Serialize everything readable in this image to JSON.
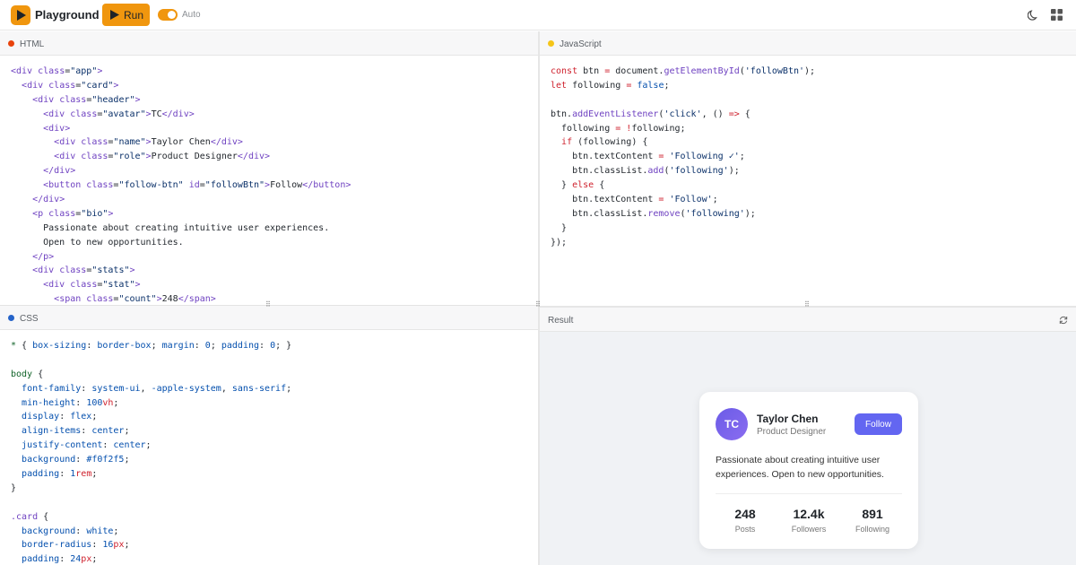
{
  "app": {
    "title": "Playground",
    "run_label": "Run",
    "auto_label": "Auto",
    "auto_enabled": true,
    "accent": "#f0960e"
  },
  "panes": {
    "html": {
      "label": "HTML",
      "dot_color": "#e8430c",
      "lines": [
        [
          [
            "t",
            "<div "
          ],
          [
            "a",
            "class"
          ],
          [
            "p",
            "="
          ],
          [
            "s",
            "\"app\""
          ],
          [
            "t",
            ">"
          ]
        ],
        [
          [
            "p",
            "  "
          ],
          [
            "t",
            "<div "
          ],
          [
            "a",
            "class"
          ],
          [
            "p",
            "="
          ],
          [
            "s",
            "\"card\""
          ],
          [
            "t",
            ">"
          ]
        ],
        [
          [
            "p",
            "    "
          ],
          [
            "t",
            "<div "
          ],
          [
            "a",
            "class"
          ],
          [
            "p",
            "="
          ],
          [
            "s",
            "\"header\""
          ],
          [
            "t",
            ">"
          ]
        ],
        [
          [
            "p",
            "      "
          ],
          [
            "t",
            "<div "
          ],
          [
            "a",
            "class"
          ],
          [
            "p",
            "="
          ],
          [
            "s",
            "\"avatar\""
          ],
          [
            "t",
            ">"
          ],
          [
            "p",
            "TC"
          ],
          [
            "t",
            "</div>"
          ]
        ],
        [
          [
            "p",
            "      "
          ],
          [
            "t",
            "<div>"
          ]
        ],
        [
          [
            "p",
            "        "
          ],
          [
            "t",
            "<div "
          ],
          [
            "a",
            "class"
          ],
          [
            "p",
            "="
          ],
          [
            "s",
            "\"name\""
          ],
          [
            "t",
            ">"
          ],
          [
            "p",
            "Taylor Chen"
          ],
          [
            "t",
            "</div>"
          ]
        ],
        [
          [
            "p",
            "        "
          ],
          [
            "t",
            "<div "
          ],
          [
            "a",
            "class"
          ],
          [
            "p",
            "="
          ],
          [
            "s",
            "\"role\""
          ],
          [
            "t",
            ">"
          ],
          [
            "p",
            "Product Designer"
          ],
          [
            "t",
            "</div>"
          ]
        ],
        [
          [
            "p",
            "      "
          ],
          [
            "t",
            "</div>"
          ]
        ],
        [
          [
            "p",
            "      "
          ],
          [
            "t",
            "<button "
          ],
          [
            "a",
            "class"
          ],
          [
            "p",
            "="
          ],
          [
            "s",
            "\"follow-btn\""
          ],
          [
            "p",
            " "
          ],
          [
            "a",
            "id"
          ],
          [
            "p",
            "="
          ],
          [
            "s",
            "\"followBtn\""
          ],
          [
            "t",
            ">"
          ],
          [
            "p",
            "Follow"
          ],
          [
            "t",
            "</button>"
          ]
        ],
        [
          [
            "p",
            "    "
          ],
          [
            "t",
            "</div>"
          ]
        ],
        [
          [
            "p",
            "    "
          ],
          [
            "t",
            "<p "
          ],
          [
            "a",
            "class"
          ],
          [
            "p",
            "="
          ],
          [
            "s",
            "\"bio\""
          ],
          [
            "t",
            ">"
          ]
        ],
        [
          [
            "p",
            "      Passionate about creating intuitive user experiences."
          ]
        ],
        [
          [
            "p",
            "      Open to new opportunities."
          ]
        ],
        [
          [
            "p",
            "    "
          ],
          [
            "t",
            "</p>"
          ]
        ],
        [
          [
            "p",
            "    "
          ],
          [
            "t",
            "<div "
          ],
          [
            "a",
            "class"
          ],
          [
            "p",
            "="
          ],
          [
            "s",
            "\"stats\""
          ],
          [
            "t",
            ">"
          ]
        ],
        [
          [
            "p",
            "      "
          ],
          [
            "t",
            "<div "
          ],
          [
            "a",
            "class"
          ],
          [
            "p",
            "="
          ],
          [
            "s",
            "\"stat\""
          ],
          [
            "t",
            ">"
          ]
        ],
        [
          [
            "p",
            "        "
          ],
          [
            "t",
            "<span "
          ],
          [
            "a",
            "class"
          ],
          [
            "p",
            "="
          ],
          [
            "s",
            "\"count\""
          ],
          [
            "t",
            ">"
          ],
          [
            "p",
            "248"
          ],
          [
            "t",
            "</span>"
          ]
        ]
      ]
    },
    "js": {
      "label": "JavaScript",
      "dot_color": "#f5c518",
      "lines": [
        [
          [
            "k",
            "const "
          ],
          [
            "p",
            "btn "
          ],
          [
            "k",
            "= "
          ],
          [
            "p",
            "document."
          ],
          [
            "t",
            "getElementById"
          ],
          [
            "p",
            "("
          ],
          [
            "s",
            "'followBtn'"
          ],
          [
            "p",
            ");"
          ]
        ],
        [
          [
            "k",
            "let "
          ],
          [
            "p",
            "following "
          ],
          [
            "k",
            "= "
          ],
          [
            "val",
            "false"
          ],
          [
            "p",
            ";"
          ]
        ],
        [
          [
            "p",
            ""
          ]
        ],
        [
          [
            "p",
            "btn."
          ],
          [
            "t",
            "addEventListener"
          ],
          [
            "p",
            "("
          ],
          [
            "s",
            "'click'"
          ],
          [
            "p",
            ", () "
          ],
          [
            "k",
            "=> "
          ],
          [
            "p",
            "{"
          ]
        ],
        [
          [
            "p",
            "  following "
          ],
          [
            "k",
            "= "
          ],
          [
            "k",
            "!"
          ],
          [
            "p",
            "following;"
          ]
        ],
        [
          [
            "p",
            "  "
          ],
          [
            "k",
            "if "
          ],
          [
            "p",
            "(following) {"
          ]
        ],
        [
          [
            "p",
            "    btn.textContent "
          ],
          [
            "k",
            "= "
          ],
          [
            "s",
            "'Following ✓'"
          ],
          [
            "p",
            ";"
          ]
        ],
        [
          [
            "p",
            "    btn.classList."
          ],
          [
            "t",
            "add"
          ],
          [
            "p",
            "("
          ],
          [
            "s",
            "'following'"
          ],
          [
            "p",
            ");"
          ]
        ],
        [
          [
            "p",
            "  } "
          ],
          [
            "k",
            "else "
          ],
          [
            "p",
            "{"
          ]
        ],
        [
          [
            "p",
            "    btn.textContent "
          ],
          [
            "k",
            "= "
          ],
          [
            "s",
            "'Follow'"
          ],
          [
            "p",
            ";"
          ]
        ],
        [
          [
            "p",
            "    btn.classList."
          ],
          [
            "t",
            "remove"
          ],
          [
            "p",
            "("
          ],
          [
            "s",
            "'following'"
          ],
          [
            "p",
            ");"
          ]
        ],
        [
          [
            "p",
            "  }"
          ]
        ],
        [
          [
            "p",
            "});"
          ]
        ]
      ]
    },
    "css": {
      "label": "CSS",
      "dot_color": "#2563c9",
      "lines": [
        [
          [
            "sel",
            "* "
          ],
          [
            "p",
            "{ "
          ],
          [
            "prop",
            "box-sizing"
          ],
          [
            "p",
            ": "
          ],
          [
            "val",
            "border-box"
          ],
          [
            "p",
            "; "
          ],
          [
            "prop",
            "margin"
          ],
          [
            "p",
            ": "
          ],
          [
            "val",
            "0"
          ],
          [
            "p",
            "; "
          ],
          [
            "prop",
            "padding"
          ],
          [
            "p",
            ": "
          ],
          [
            "val",
            "0"
          ],
          [
            "p",
            "; }"
          ]
        ],
        [
          [
            "p",
            ""
          ]
        ],
        [
          [
            "sel",
            "body "
          ],
          [
            "p",
            "{"
          ]
        ],
        [
          [
            "p",
            "  "
          ],
          [
            "prop",
            "font-family"
          ],
          [
            "p",
            ": "
          ],
          [
            "val",
            "system-ui"
          ],
          [
            "p",
            ", "
          ],
          [
            "val",
            "-apple-system"
          ],
          [
            "p",
            ", "
          ],
          [
            "val",
            "sans-serif"
          ],
          [
            "p",
            ";"
          ]
        ],
        [
          [
            "p",
            "  "
          ],
          [
            "prop",
            "min-height"
          ],
          [
            "p",
            ": "
          ],
          [
            "val",
            "100"
          ],
          [
            "unit",
            "vh"
          ],
          [
            "p",
            ";"
          ]
        ],
        [
          [
            "p",
            "  "
          ],
          [
            "prop",
            "display"
          ],
          [
            "p",
            ": "
          ],
          [
            "val",
            "flex"
          ],
          [
            "p",
            ";"
          ]
        ],
        [
          [
            "p",
            "  "
          ],
          [
            "prop",
            "align-items"
          ],
          [
            "p",
            ": "
          ],
          [
            "val",
            "center"
          ],
          [
            "p",
            ";"
          ]
        ],
        [
          [
            "p",
            "  "
          ],
          [
            "prop",
            "justify-content"
          ],
          [
            "p",
            ": "
          ],
          [
            "val",
            "center"
          ],
          [
            "p",
            ";"
          ]
        ],
        [
          [
            "p",
            "  "
          ],
          [
            "prop",
            "background"
          ],
          [
            "p",
            ": "
          ],
          [
            "val",
            "#f0f2f5"
          ],
          [
            "p",
            ";"
          ]
        ],
        [
          [
            "p",
            "  "
          ],
          [
            "prop",
            "padding"
          ],
          [
            "p",
            ": "
          ],
          [
            "val",
            "1"
          ],
          [
            "unit",
            "rem"
          ],
          [
            "p",
            ";"
          ]
        ],
        [
          [
            "p",
            "}"
          ]
        ],
        [
          [
            "p",
            ""
          ]
        ],
        [
          [
            "t",
            ".card "
          ],
          [
            "p",
            "{"
          ]
        ],
        [
          [
            "p",
            "  "
          ],
          [
            "prop",
            "background"
          ],
          [
            "p",
            ": "
          ],
          [
            "val",
            "white"
          ],
          [
            "p",
            ";"
          ]
        ],
        [
          [
            "p",
            "  "
          ],
          [
            "prop",
            "border-radius"
          ],
          [
            "p",
            ": "
          ],
          [
            "val",
            "16"
          ],
          [
            "unit",
            "px"
          ],
          [
            "p",
            ";"
          ]
        ],
        [
          [
            "p",
            "  "
          ],
          [
            "prop",
            "padding"
          ],
          [
            "p",
            ": "
          ],
          [
            "val",
            "24"
          ],
          [
            "unit",
            "px"
          ],
          [
            "p",
            ";"
          ]
        ]
      ]
    },
    "result": {
      "label": "Result"
    }
  },
  "profile": {
    "initials": "TC",
    "name": "Taylor Chen",
    "role": "Product Designer",
    "follow_label": "Follow",
    "bio": "Passionate about creating intuitive user experiences. Open to new opportunities.",
    "button_color": "#6366f1",
    "stats": [
      {
        "count": "248",
        "label": "Posts"
      },
      {
        "count": "12.4k",
        "label": "Followers"
      },
      {
        "count": "891",
        "label": "Following"
      }
    ]
  }
}
